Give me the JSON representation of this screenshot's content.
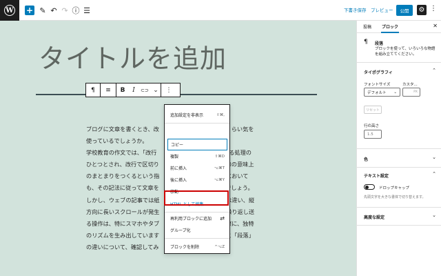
{
  "topbar": {
    "wp_logo": "W",
    "add_symbol": "+",
    "tool_symbol": "✎",
    "undo_symbol": "↶",
    "redo_symbol": "↷",
    "info_symbol": "ⓘ",
    "list_symbol": "☰",
    "save_draft": "下書き保存",
    "preview": "プレビュー",
    "publish": "公開",
    "settings_symbol": "⚙",
    "more_symbol": "⋮"
  },
  "editor": {
    "title": "タイトルを追加",
    "paragraph": [
      "ブログに文章を書くとき、改                                  れくらい気を",
      "使っているでしょうか。",
      "学校教育の作文では、「改行                                  形する処理の",
      "ひとつとされ、改行で区切り                                  文章の意味上",
      "のまとまりをつくるという指                                  ブにおいて",
      "も、その記法に従って文章を                                  いでしょう。",
      "しかし、ウェブの記事では紙                                  とは違い、縦",
      "方向に長いスクロールが発生                                  に繰り返し送",
      "る操作は、特にスマホやタブ                                  る際に、独特",
      "のリズムを生み出しています                                  」と「段落」",
      "の違いについて、確認してみ"
    ]
  },
  "block_toolbar": {
    "paragraph_symbol": "¶",
    "align_symbol": "≡",
    "bold": "B",
    "italic": "I",
    "link_symbol": "⊂⊃",
    "more_rich_symbol": "⌄",
    "options_symbol": "⋮"
  },
  "menu": {
    "items": [
      {
        "label": "追加設定を非表示",
        "shortcut": "⇧⌘,"
      },
      {
        "label": "コピー",
        "shortcut": ""
      },
      {
        "label": "複製",
        "shortcut": "⇧⌘D"
      },
      {
        "label": "前に挿入",
        "shortcut": "⌥⌘T"
      },
      {
        "label": "後に挿入",
        "shortcut": "⌥⌘Y"
      },
      {
        "label": "移動",
        "shortcut": ""
      },
      {
        "label": "HTML として編集",
        "shortcut": ""
      },
      {
        "label": "再利用ブロックに追加",
        "shortcut": "⇄"
      },
      {
        "label": "グループ化",
        "shortcut": ""
      },
      {
        "label": "ブロックを削除",
        "shortcut": "^⌥Z"
      }
    ]
  },
  "sidebar": {
    "tab_post": "投稿",
    "tab_block": "ブロック",
    "close_symbol": "✕",
    "block_icon": "¶",
    "block_name": "段落",
    "block_desc": "ブロックを使って、いろいろな物語を組み立ててください。",
    "typography": "タイポグラフィ",
    "font_size_label": "フォントサイズ",
    "custom_label": "カスタ...",
    "font_size_value": "デフォルト",
    "custom_unit": "PX",
    "reset": "リセット",
    "line_height_label": "行の高さ",
    "line_height_value": "1.5",
    "color": "色",
    "text_settings": "テキスト設定",
    "drop_cap": "ドロップキャップ",
    "drop_cap_desc": "先頭文字を大きな書体で切り替えます。",
    "advanced": "高度な設定",
    "chevron_up": "⌃",
    "chevron_down": "⌄"
  },
  "colors": {
    "accent": "#007cba",
    "canvas": "#d2e3dc",
    "highlight": "#cc0000"
  }
}
